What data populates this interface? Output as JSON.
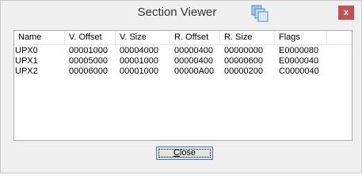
{
  "window": {
    "title": "Section Viewer",
    "close_symbol": "x"
  },
  "icons": {
    "app": "stacked-windows-icon",
    "close": "close-icon"
  },
  "table": {
    "columns": [
      "Name",
      "V. Offset",
      "V. Size",
      "R. Offset",
      "R. Size",
      "Flags"
    ],
    "rows": [
      [
        "UPX0",
        "00001000",
        "00004000",
        "00000400",
        "00000000",
        "E0000080"
      ],
      [
        "UPX1",
        "00005000",
        "00001000",
        "00000400",
        "00000600",
        "E0000040"
      ],
      [
        "UPX2",
        "00006000",
        "00001000",
        "00000A00",
        "00000200",
        "C0000040"
      ]
    ]
  },
  "buttons": {
    "close_label": "Close"
  }
}
